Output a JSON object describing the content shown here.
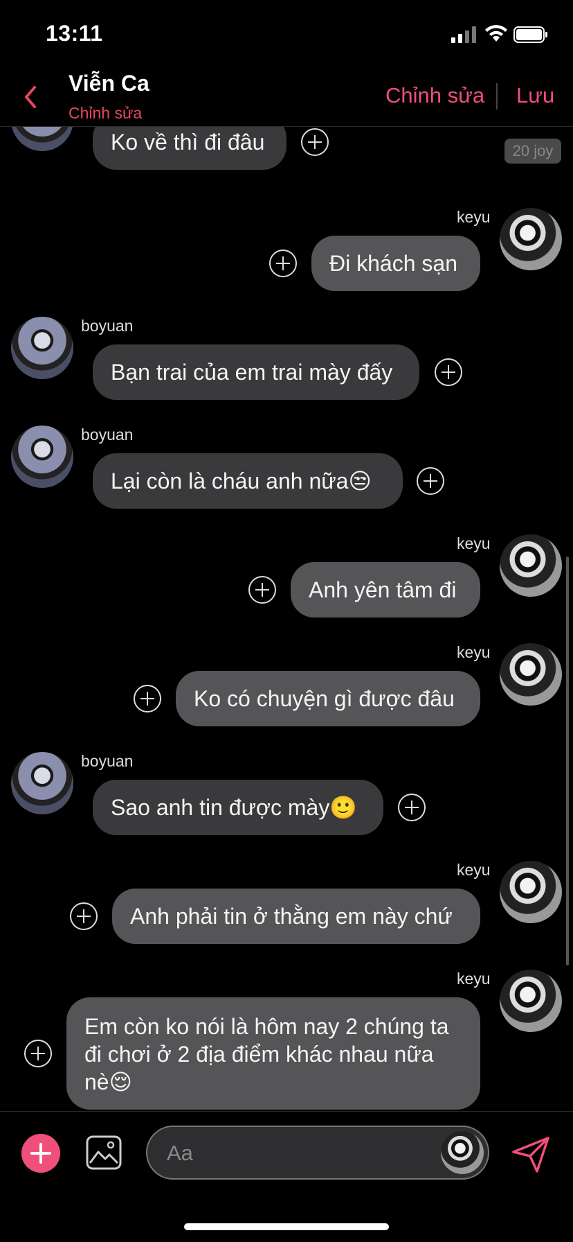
{
  "status_bar": {
    "time": "13:11"
  },
  "header": {
    "title": "Viễn Ca",
    "subtitle": "Chỉnh sửa",
    "edit_label": "Chỉnh sửa",
    "save_label": "Lưu"
  },
  "badge": {
    "joy": "20 joy"
  },
  "messages": [
    {
      "sender": "",
      "text": "Ko về thì đi đâu"
    },
    {
      "sender": "keyu",
      "text": "Đi khách sạn"
    },
    {
      "sender": "boyuan",
      "text": "Bạn trai của em trai mày đấy"
    },
    {
      "sender": "boyuan",
      "text": "Lại còn là cháu anh nữa😒"
    },
    {
      "sender": "keyu",
      "text": "Anh yên tâm đi"
    },
    {
      "sender": "keyu",
      "text": "Ko có chuyện gì được đâu"
    },
    {
      "sender": "boyuan",
      "text": "Sao anh tin được mày🙂"
    },
    {
      "sender": "keyu",
      "text": "Anh phải tin ở thằng em này chứ"
    },
    {
      "sender": "keyu",
      "text": "Em còn ko nói là hôm nay 2 chúng ta đi chơi ở 2 địa điểm khác nhau nữa nè😌"
    }
  ],
  "composer": {
    "placeholder": "Aa"
  },
  "colors": {
    "accent": "#ef4f7a",
    "incoming_bubble": "#3a3a3c",
    "outgoing_bubble": "#555558"
  },
  "icons": [
    "back-chevron-icon",
    "plus-circle-icon",
    "image-icon",
    "send-icon",
    "signal-icon",
    "wifi-icon",
    "battery-icon"
  ]
}
